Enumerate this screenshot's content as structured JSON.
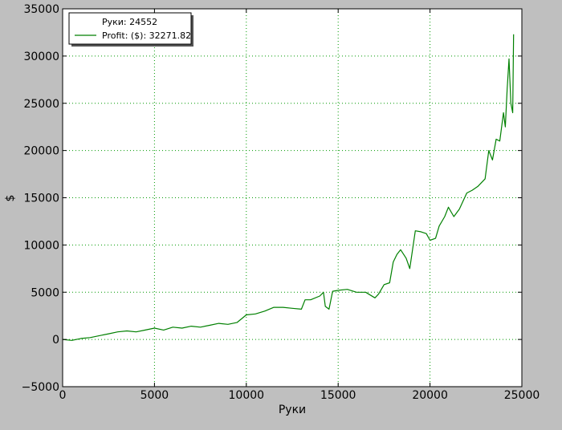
{
  "chart_data": {
    "type": "line",
    "title": "",
    "xlabel": "Руки",
    "ylabel": "$",
    "xlim": [
      0,
      25000
    ],
    "ylim": [
      -5000,
      35000
    ],
    "xticks": [
      0,
      5000,
      10000,
      15000,
      20000,
      25000
    ],
    "yticks": [
      -5000,
      0,
      5000,
      10000,
      15000,
      20000,
      25000,
      30000,
      35000
    ],
    "xtick_labels": [
      "0",
      "5000",
      "10000",
      "15000",
      "20000",
      "25000"
    ],
    "ytick_labels": [
      "−5000",
      "0",
      "5000",
      "10000",
      "15000",
      "20000",
      "25000",
      "30000",
      "35000"
    ],
    "grid": true,
    "legend": {
      "placement": "top-left",
      "entries": [
        {
          "text": "Руки: 24552",
          "marker": false
        },
        {
          "text": "Profit: ($): 32271.82",
          "marker": true
        }
      ]
    },
    "series": [
      {
        "name": "Profit: ($): 32271.82",
        "color": "#008000",
        "x": [
          0,
          500,
          1000,
          1500,
          2000,
          2500,
          3000,
          3500,
          4000,
          4500,
          5000,
          5500,
          6000,
          6500,
          7000,
          7500,
          8000,
          8500,
          9000,
          9500,
          10000,
          10500,
          11000,
          11500,
          12000,
          12500,
          13000,
          13200,
          13500,
          14000,
          14200,
          14300,
          14500,
          14700,
          15000,
          15500,
          16000,
          16500,
          17000,
          17200,
          17500,
          17800,
          18000,
          18200,
          18400,
          18700,
          18900,
          19200,
          19500,
          19800,
          20000,
          20300,
          20500,
          20800,
          21000,
          21300,
          21600,
          22000,
          22300,
          22600,
          23000,
          23200,
          23400,
          23600,
          23800,
          24000,
          24100,
          24200,
          24300,
          24400,
          24500,
          24552
        ],
        "y": [
          0,
          -100,
          100,
          200,
          400,
          600,
          800,
          900,
          800,
          1000,
          1200,
          1000,
          1300,
          1200,
          1400,
          1300,
          1500,
          1700,
          1600,
          1800,
          2600,
          2700,
          3000,
          3400,
          3400,
          3300,
          3200,
          4200,
          4200,
          4600,
          5000,
          3500,
          3200,
          5100,
          5200,
          5300,
          5000,
          5000,
          4400,
          4800,
          5800,
          6000,
          8200,
          9000,
          9500,
          8600,
          7500,
          11500,
          11400,
          11200,
          10500,
          10700,
          12000,
          13000,
          14000,
          13000,
          13800,
          15500,
          15800,
          16200,
          17000,
          20000,
          19000,
          21200,
          21000,
          24000,
          22500,
          26500,
          29700,
          25000,
          24000,
          32300
        ]
      }
    ]
  }
}
